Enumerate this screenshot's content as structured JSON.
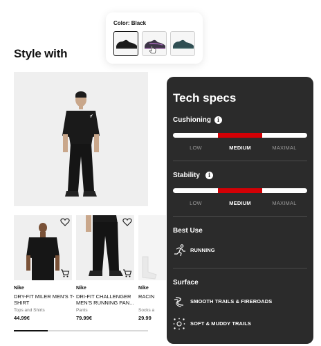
{
  "color_picker": {
    "label": "Color: Black",
    "swatches": [
      {
        "name": "black",
        "selected": true,
        "colors": [
          "#1a1a1a",
          "#3a3a3a"
        ]
      },
      {
        "name": "purple",
        "selected": false,
        "colors": [
          "#3d3547",
          "#7d4a8a"
        ]
      },
      {
        "name": "teal",
        "selected": false,
        "colors": [
          "#2f4e52",
          "#587a7a"
        ]
      }
    ]
  },
  "style_with": {
    "title": "Style with",
    "products": [
      {
        "brand": "Nike",
        "name": "DRY-FIT MILER MEN'S T-SHIRT",
        "category": "Tops and Shirts",
        "price": "44.99€"
      },
      {
        "brand": "Nike",
        "name": "DRI-FIT CHALLENGER MEN'S RUNNING PAN...",
        "category": "Pants",
        "price": "79.99€"
      },
      {
        "brand": "Nike",
        "name": "RACIN",
        "category": "Socks a",
        "price": "29.99"
      }
    ],
    "scroll_progress": 0.25
  },
  "tech_specs": {
    "title": "Tech specs",
    "cushioning": {
      "label": "Cushioning",
      "levels": [
        "LOW",
        "MEDIUM",
        "MAXIMAL"
      ],
      "selected": "MEDIUM"
    },
    "stability": {
      "label": "Stability",
      "levels": [
        "LOW",
        "MEDIUM",
        "MAXIMAL"
      ],
      "selected": "MEDIUM"
    },
    "best_use": {
      "label": "Best Use",
      "items": [
        {
          "icon": "runner-icon",
          "text": "RUNNING"
        }
      ]
    },
    "surface": {
      "label": "Surface",
      "items": [
        {
          "icon": "smooth-trails-icon",
          "text": "SMOOTH TRAILS & FIREROADS"
        },
        {
          "icon": "muddy-trails-icon",
          "text": "SOFT & MUDDY TRAILS"
        }
      ]
    }
  },
  "colors": {
    "accent_red": "#d30005",
    "panel_bg": "#2b2b2b"
  }
}
